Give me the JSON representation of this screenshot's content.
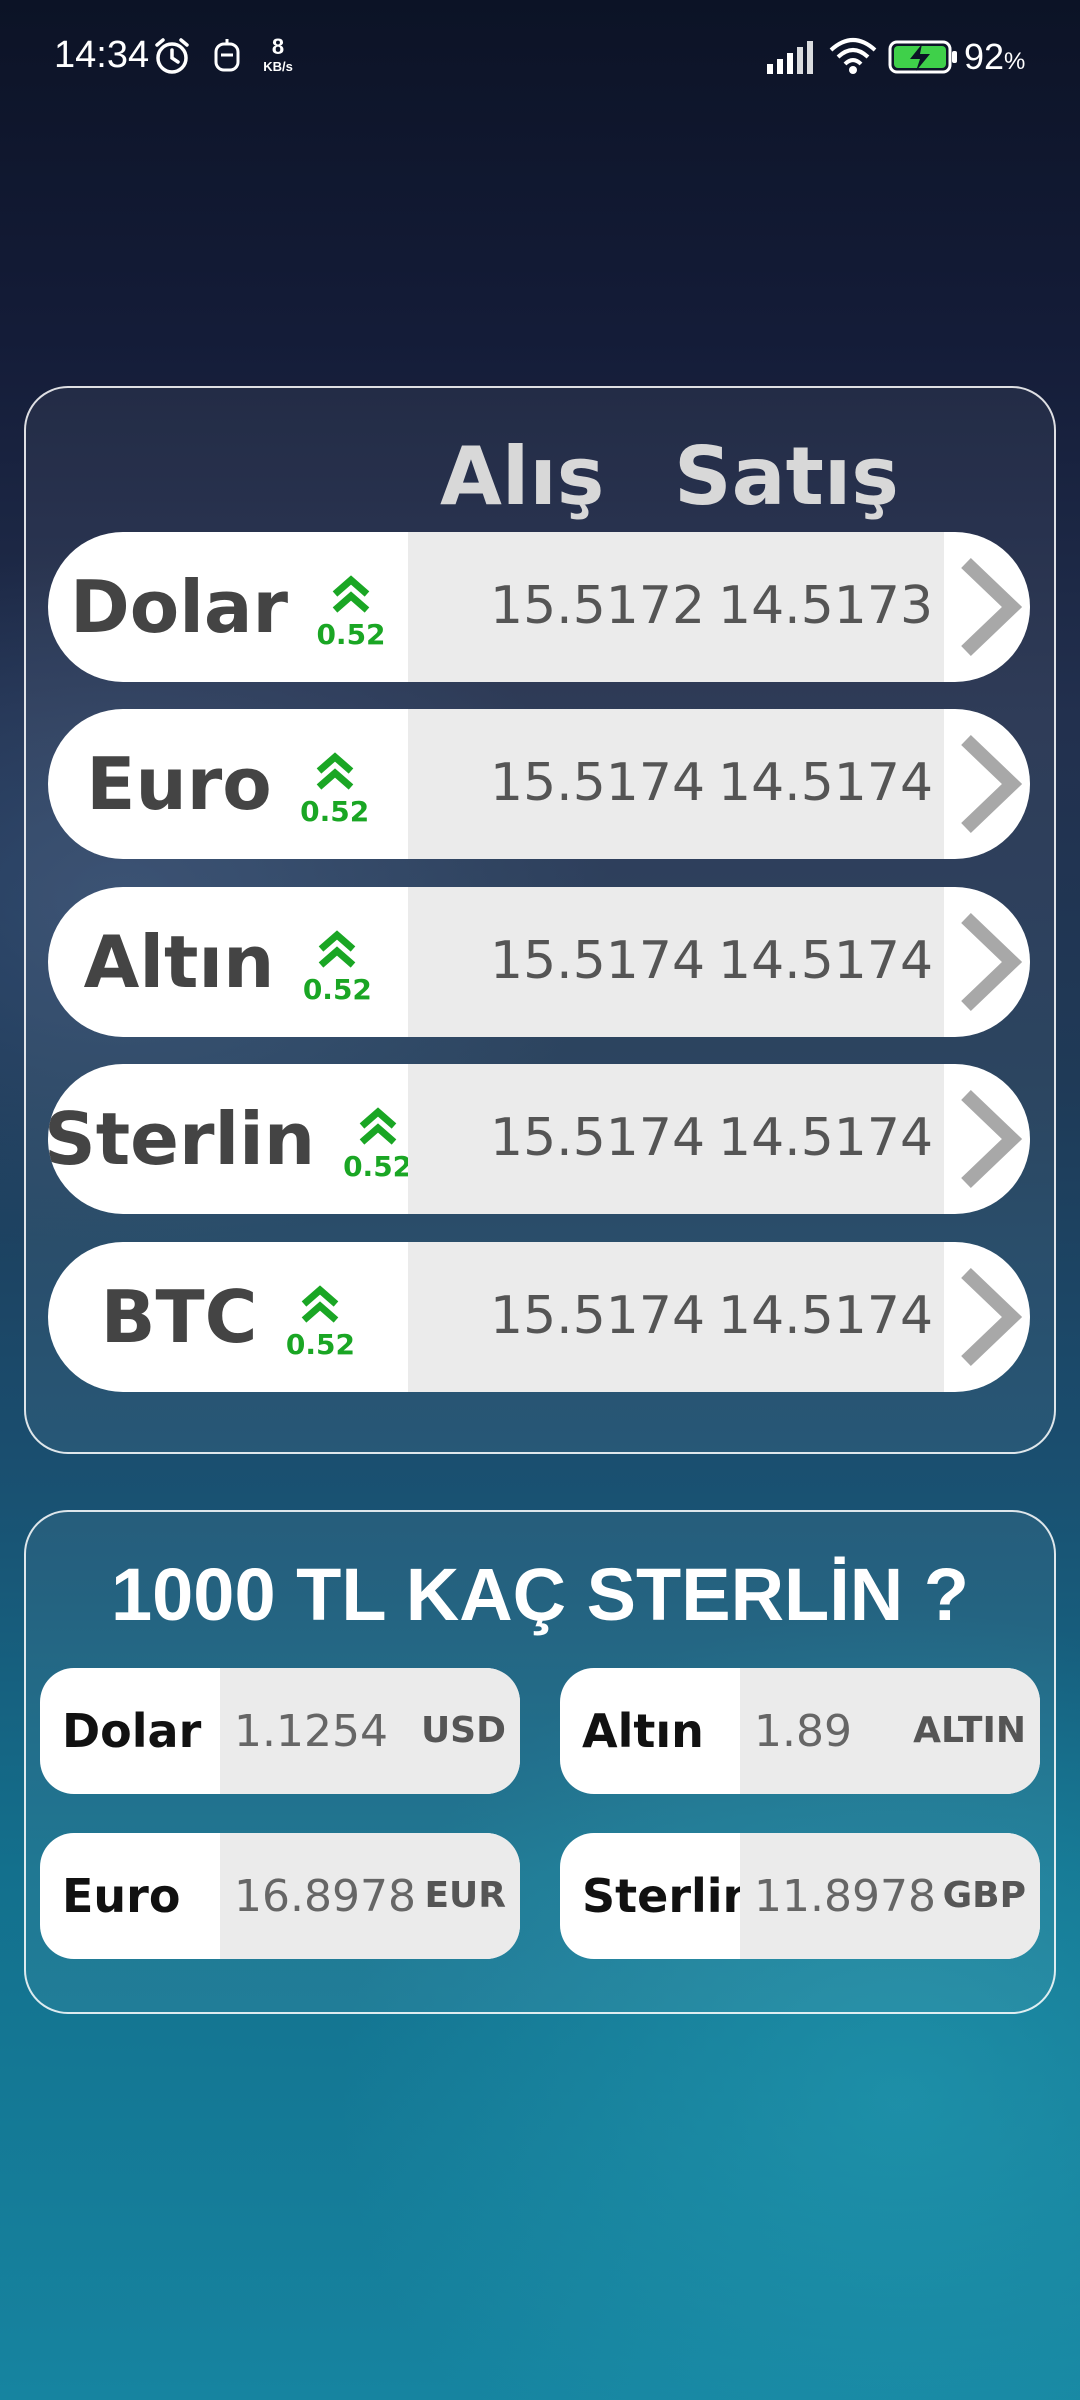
{
  "status_bar": {
    "time": "14:34",
    "net_speed": "8",
    "net_unit": "KB/s",
    "battery": "92",
    "battery_unit": "%",
    "icons": [
      "alarm-icon",
      "bot-icon",
      "signal-icon",
      "wifi-icon",
      "battery-charging-icon"
    ]
  },
  "rates": {
    "header_buy": "Alış",
    "header_sell": "Satış",
    "rows": [
      {
        "name": "Dolar",
        "change": "0.52",
        "buy": "15.5172",
        "sell": "14.5173"
      },
      {
        "name": "Euro",
        "change": "0.52",
        "buy": "15.5174",
        "sell": "14.5174"
      },
      {
        "name": "Altın",
        "change": "0.52",
        "buy": "15.5174",
        "sell": "14.5174"
      },
      {
        "name": "Sterlin",
        "change": "0.52",
        "buy": "15.5174",
        "sell": "14.5174"
      },
      {
        "name": "BTC",
        "change": "0.52",
        "buy": "15.5174",
        "sell": "14.5174"
      }
    ]
  },
  "converter": {
    "title": "1000 TL KAÇ STERLİN ?",
    "cards": [
      {
        "name": "Dolar",
        "amount": "1.1254",
        "code": "USD"
      },
      {
        "name": "Altın",
        "amount": "1.89",
        "code": "ALTIN"
      },
      {
        "name": "Euro",
        "amount": "16.8978",
        "code": "EUR"
      },
      {
        "name": "Sterlin",
        "amount": "11.8978",
        "code": "GBP"
      }
    ]
  },
  "colors": {
    "up_green": "#1aa624",
    "row_bg": "#ffffff",
    "value_bg": "#ebebeb",
    "chevron": "#a8a8a8"
  }
}
